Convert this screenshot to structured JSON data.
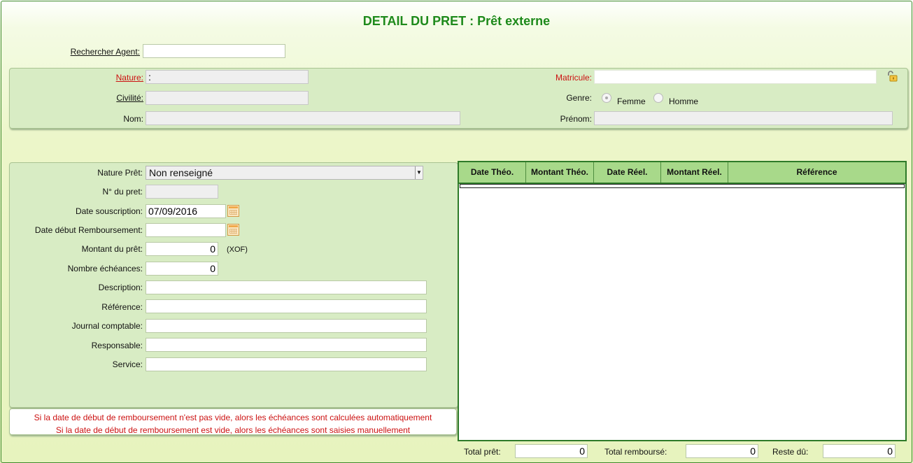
{
  "title": "DETAIL DU PRET : Prêt externe",
  "search": {
    "label": "Rechercher Agent:",
    "value": ""
  },
  "agent": {
    "nature_label": "Nature:",
    "nature_value": ":",
    "civilite_label": "Civilité:",
    "civilite_value": "",
    "nom_label": "Nom:",
    "nom_value": "",
    "matricule_label": "Matricule:",
    "matricule_value": "",
    "genre_label": "Genre:",
    "genre_options": [
      "Femme",
      "Homme"
    ],
    "prenom_label": "Prénom:",
    "prenom_value": ""
  },
  "loan": {
    "nature_pret_label": "Nature Prêt:",
    "nature_pret_value": "Non renseigné",
    "numero_label": "N° du pret:",
    "numero_value": "",
    "date_souscription_label": "Date souscription:",
    "date_souscription_value": "07/09/2016",
    "date_debut_label": "Date début Remboursement:",
    "date_debut_value": "",
    "montant_label": "Montant du prêt:",
    "montant_value": "0",
    "currency": "(XOF)",
    "nb_echeances_label": "Nombre échéances:",
    "nb_echeances_value": "0",
    "description_label": "Description:",
    "reference_label": "Référence:",
    "journal_label": "Journal comptable:",
    "responsable_label": "Responsable:",
    "service_label": "Service:"
  },
  "notes": [
    "Si la date de début de remboursement n'est pas vide, alors les échéances sont calculées automatiquement",
    "Si la date de début de remboursement est vide, alors les échéances sont saisies manuellement"
  ],
  "schedule": {
    "columns": [
      "Date Théo.",
      "Montant Théo.",
      "Date Réel.",
      "Montant Réel.",
      "Référence"
    ]
  },
  "totals": {
    "total_pret_label": "Total prêt:",
    "total_pret_value": "0",
    "total_rembourse_label": "Total remboursé:",
    "total_rembourse_value": "0",
    "reste_du_label": "Reste dû:",
    "reste_du_value": "0"
  },
  "icons": {
    "calendar": "calendar-icon",
    "lock": "unlock-icon",
    "dropdown": "chevron-down-icon"
  },
  "colors": {
    "title": "#1e8a1b",
    "required": "#cc1111",
    "grid_header": "#a8d98a",
    "panel": "#d8ecc4"
  }
}
